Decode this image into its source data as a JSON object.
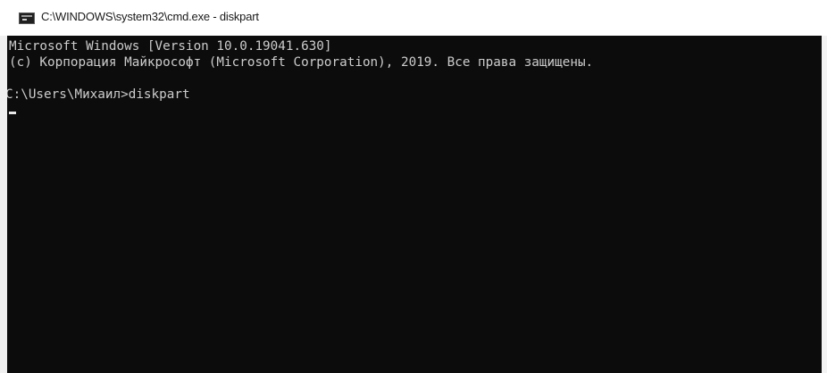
{
  "window": {
    "title": "C:\\WINDOWS\\system32\\cmd.exe - diskpart",
    "icon": "cmd-icon"
  },
  "console": {
    "lines": [
      "Microsoft Windows [Version 10.0.19041.630]",
      "(c) Корпорация Майкрософт (Microsoft Corporation), 2019. Все права защищены.",
      "C:\\Users\\Михаил>diskpart"
    ],
    "colors": {
      "background": "#0c0c0c",
      "text": "#cccccc"
    }
  }
}
